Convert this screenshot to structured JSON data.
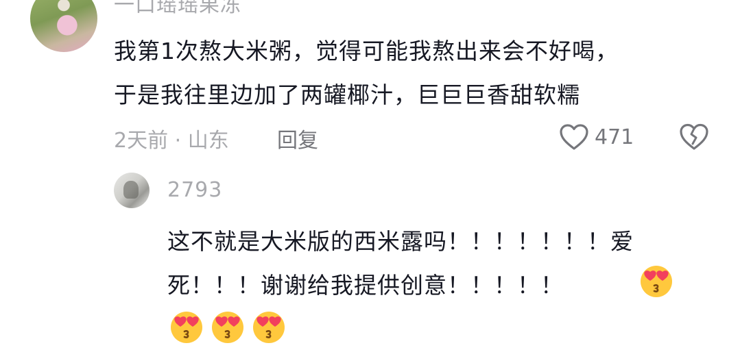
{
  "main_comment": {
    "username": "一口瑶瑶果冻",
    "lines": [
      "我第1次熬大米粥，觉得可能我熬出来会不好喝，",
      "于是我往里边加了两罐椰汁，巨巨巨香甜软糯"
    ],
    "time_location": "2天前 · 山东",
    "reply_label": "回复",
    "like_count": "471"
  },
  "reply_comment": {
    "username": "2793",
    "lines": [
      "这不就是大米版的西米露吗！！！！！！！爱",
      "死！！！谢谢给我提供创意！！！！！"
    ],
    "emoji_count_inline": 1,
    "emoji_count_trailing": 3
  },
  "icons": {
    "like": "heart-outline-icon",
    "dislike": "broken-heart-icon",
    "emoji": "heart-eyes-kiss-emoji"
  },
  "colors": {
    "text": "#161823",
    "muted": "#a8a9ad",
    "secondary": "#75767b",
    "emoji_face": "#ffc83d",
    "emoji_heart": "#f2405d"
  }
}
